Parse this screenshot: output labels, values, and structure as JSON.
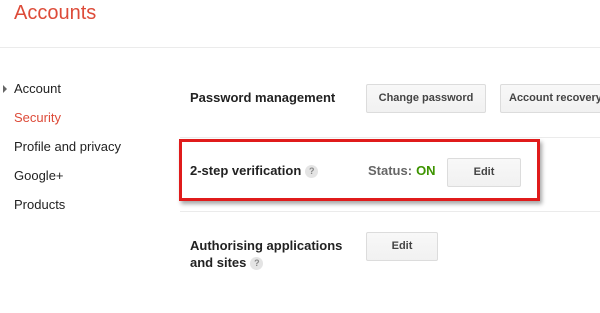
{
  "app": {
    "title": "Accounts"
  },
  "sidebar": {
    "items": [
      {
        "label": "Account"
      },
      {
        "label": "Security"
      },
      {
        "label": "Profile and privacy"
      },
      {
        "label": "Google+"
      },
      {
        "label": "Products"
      }
    ]
  },
  "security": {
    "password_management": {
      "label": "Password management",
      "change_password_button": "Change password",
      "account_recovery_button": "Account recovery options"
    },
    "two_step": {
      "label": "2-step verification",
      "help": "?",
      "status_label": "Status:",
      "status_value": "ON",
      "edit_button": "Edit"
    },
    "authorising_apps": {
      "label_line1": "Authorising applications",
      "label_line2": "and sites",
      "help": "?",
      "edit_button": "Edit"
    }
  },
  "colors": {
    "accent": "#dd4b39",
    "status_on": "#3d9400",
    "highlight": "#e01b1b"
  }
}
